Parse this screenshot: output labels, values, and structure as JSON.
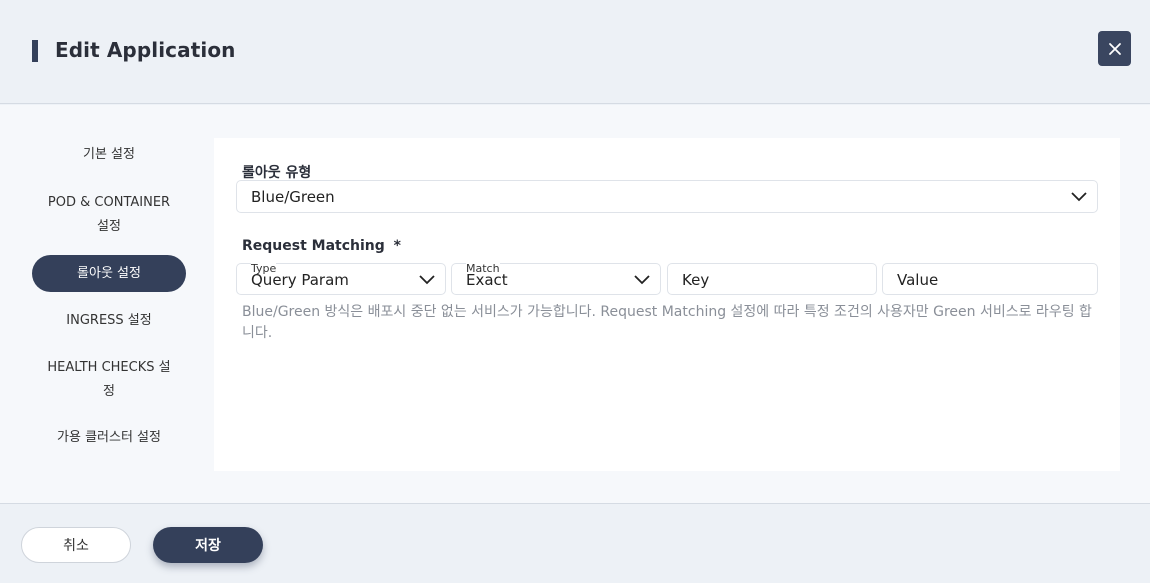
{
  "header": {
    "title": "Edit Application"
  },
  "sidebar": {
    "items": [
      {
        "label": "기본 설정"
      },
      {
        "label": "POD & CONTAINER 설정"
      },
      {
        "label": "롤아웃 설정"
      },
      {
        "label": "INGRESS 설정"
      },
      {
        "label": "HEALTH CHECKS 설정"
      },
      {
        "label": "가용 클러스터 설정"
      }
    ],
    "active_index": 2
  },
  "form": {
    "rollout_type_label": "롤아웃 유형",
    "rollout_type_value": "Blue/Green",
    "request_matching_label": "Request Matching",
    "required_mark": "*",
    "type_label": "Type",
    "type_value": "Query Param",
    "match_label": "Match",
    "match_value": "Exact",
    "key_placeholder": "Key",
    "value_placeholder": "Value",
    "helper_text": "Blue/Green 방식은 배포시 중단 없는 서비스가 가능합니다. Request Matching 설정에 따라 특정 조건의 사용자만 Green 서비스로 라우팅 합니다."
  },
  "footer": {
    "cancel_label": "취소",
    "save_label": "저장"
  },
  "colors": {
    "accent": "#34405a"
  }
}
